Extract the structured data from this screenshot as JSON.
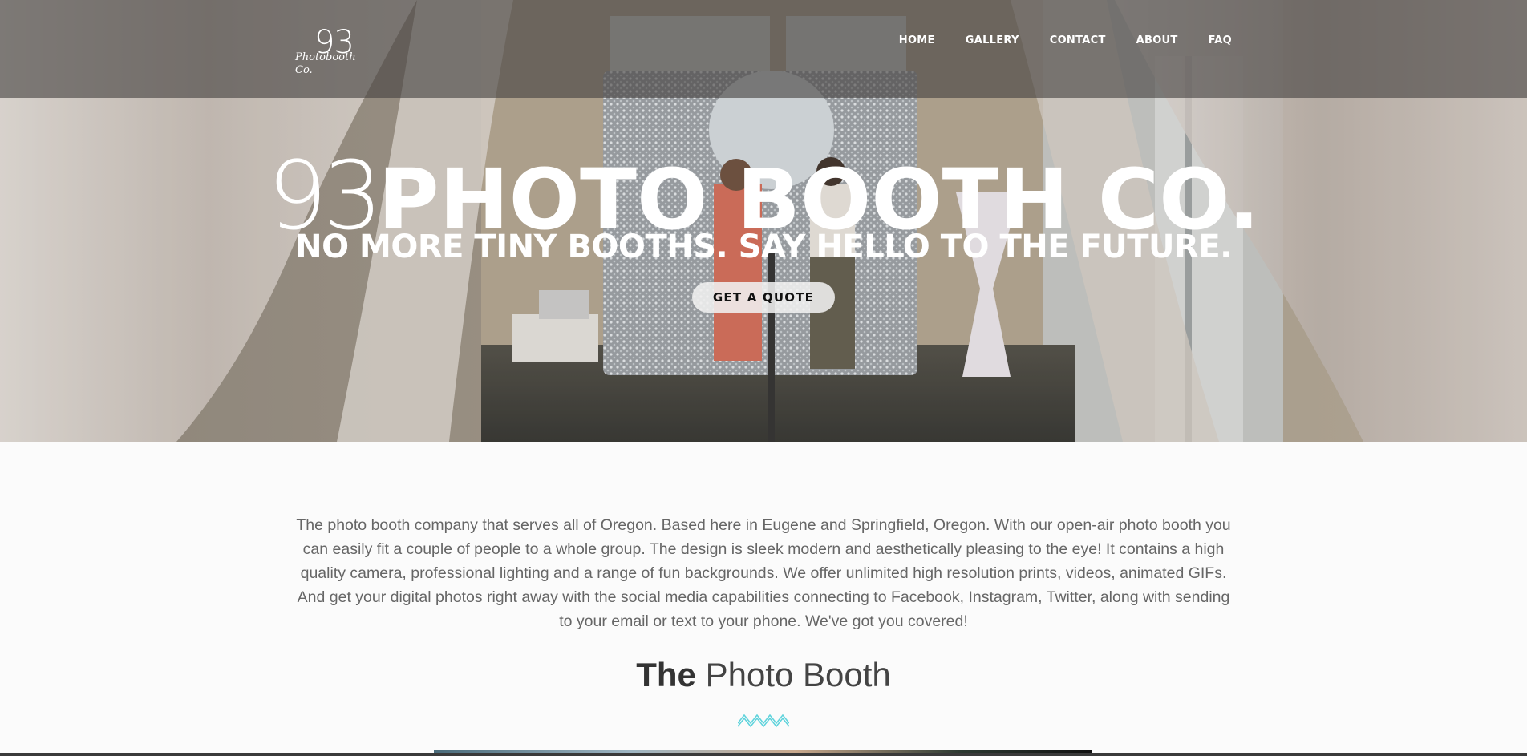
{
  "header": {
    "logo": {
      "number": "93",
      "script": "Photobooth Co."
    },
    "nav": [
      "HOME",
      "GALLERY",
      "CONTACT",
      "ABOUT",
      "FAQ"
    ]
  },
  "hero": {
    "title_number": "93",
    "title_name": "PHOTO BOOTH CO.",
    "subtitle": "NO MORE TINY BOOTHS. SAY HELLO TO THE FUTURE.",
    "cta_label": "GET A QUOTE"
  },
  "main": {
    "intro": "The photo booth company that serves all of Oregon. Based here in Eugene and Springfield, Oregon. With our open-air photo booth you can easily fit a couple of people to a whole group. The design is sleek modern and aesthetically pleasing to the eye! It contains a high quality camera, professional lighting and a range of fun backgrounds. We offer unlimited high resolution prints, videos, animated GIFs. And get your digital photos right away with the social media capabilities connecting to Facebook, Instagram, Twitter, along with sending to your email or text to your phone. We've got you covered!",
    "section_title_bold": "The",
    "section_title_light": "Photo Booth"
  },
  "colors": {
    "accent": "#5fd3dc",
    "nav_overlay": "#464240",
    "body_text": "#666666",
    "heading": "#333333"
  },
  "icons": {
    "divider": "zigzag-divider-icon"
  }
}
